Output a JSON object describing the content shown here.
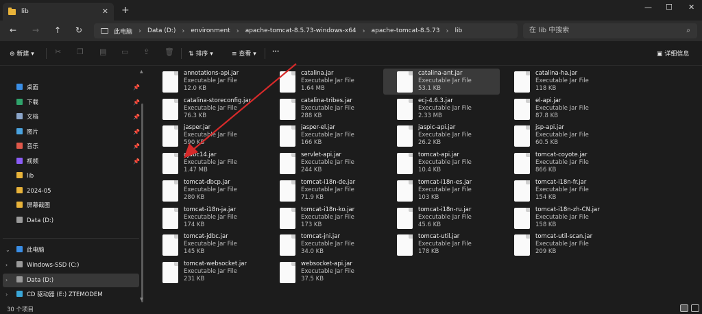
{
  "window": {
    "tab_title": "lib",
    "minimize": "—",
    "maximize": "☐",
    "close": "✕",
    "newtab": "+",
    "tab_close": "✕"
  },
  "nav": {
    "back": "←",
    "forward": "→",
    "up": "↑",
    "refresh": "↻"
  },
  "breadcrumb": [
    "此电脑",
    "Data (D:)",
    "environment",
    "apache-tomcat-8.5.73-windows-x64",
    "apache-tomcat-8.5.73",
    "lib"
  ],
  "search": {
    "placeholder": "在 lib 中搜索",
    "icon": "search-icon"
  },
  "toolbar": {
    "new_label": "新建",
    "sort_label": "排序",
    "view_label": "查看",
    "more": "···",
    "details_label": "详细信息"
  },
  "sidebar": {
    "quick": [
      {
        "label": "桌面",
        "icon": "desktop-icon",
        "color": "#3a8ee6",
        "pinned": true
      },
      {
        "label": "下载",
        "icon": "download-icon",
        "color": "#2fa36b",
        "pinned": true
      },
      {
        "label": "文档",
        "icon": "document-icon",
        "color": "#8aa4c8",
        "pinned": true
      },
      {
        "label": "图片",
        "icon": "picture-icon",
        "color": "#4aa3df",
        "pinned": true
      },
      {
        "label": "音乐",
        "icon": "music-icon",
        "color": "#e0584a",
        "pinned": true
      },
      {
        "label": "视频",
        "icon": "video-icon",
        "color": "#8b5cf6",
        "pinned": true
      },
      {
        "label": "lib",
        "icon": "folder-icon",
        "color": "#e8b33a",
        "pinned": false
      },
      {
        "label": "2024-05",
        "icon": "folder-icon",
        "color": "#e8b33a",
        "pinned": false
      },
      {
        "label": "屏幕截图",
        "icon": "folder-icon",
        "color": "#e8b33a",
        "pinned": false
      },
      {
        "label": "Data (D:)",
        "icon": "drive-icon",
        "color": "#9a9a9a",
        "pinned": false
      }
    ],
    "pc_label": "此电脑",
    "drives": [
      {
        "label": "Windows-SSD (C:)",
        "icon": "drive-icon"
      },
      {
        "label": "Data (D:)",
        "icon": "drive-icon"
      },
      {
        "label": "CD 驱动器 (E:) ZTEMODEM",
        "icon": "cd-icon"
      }
    ]
  },
  "files": [
    {
      "name": "annotations-api.jar",
      "type": "Executable Jar File",
      "size": "12.0 KB"
    },
    {
      "name": "catalina.jar",
      "type": "Executable Jar File",
      "size": "1.64 MB"
    },
    {
      "name": "catalina-ant.jar",
      "type": "Executable Jar File",
      "size": "53.1 KB",
      "selected": true
    },
    {
      "name": "catalina-ha.jar",
      "type": "Executable Jar File",
      "size": "118 KB"
    },
    {
      "name": "catalina-storeconfig.jar",
      "type": "Executable Jar File",
      "size": "76.3 KB"
    },
    {
      "name": "catalina-tribes.jar",
      "type": "Executable Jar File",
      "size": "288 KB"
    },
    {
      "name": "ecj-4.6.3.jar",
      "type": "Executable Jar File",
      "size": "2.33 MB"
    },
    {
      "name": "el-api.jar",
      "type": "Executable Jar File",
      "size": "87.8 KB"
    },
    {
      "name": "jasper.jar",
      "type": "Executable Jar File",
      "size": "590 KB"
    },
    {
      "name": "jasper-el.jar",
      "type": "Executable Jar File",
      "size": "166 KB"
    },
    {
      "name": "jaspic-api.jar",
      "type": "Executable Jar File",
      "size": "26.2 KB"
    },
    {
      "name": "jsp-api.jar",
      "type": "Executable Jar File",
      "size": "60.5 KB"
    },
    {
      "name": "ojdbc14.jar",
      "type": "Executable Jar File",
      "size": "1.47 MB"
    },
    {
      "name": "servlet-api.jar",
      "type": "Executable Jar File",
      "size": "244 KB"
    },
    {
      "name": "tomcat-api.jar",
      "type": "Executable Jar File",
      "size": "10.4 KB"
    },
    {
      "name": "tomcat-coyote.jar",
      "type": "Executable Jar File",
      "size": "866 KB"
    },
    {
      "name": "tomcat-dbcp.jar",
      "type": "Executable Jar File",
      "size": "280 KB"
    },
    {
      "name": "tomcat-i18n-de.jar",
      "type": "Executable Jar File",
      "size": "71.9 KB"
    },
    {
      "name": "tomcat-i18n-es.jar",
      "type": "Executable Jar File",
      "size": "103 KB"
    },
    {
      "name": "tomcat-i18n-fr.jar",
      "type": "Executable Jar File",
      "size": "154 KB"
    },
    {
      "name": "tomcat-i18n-ja.jar",
      "type": "Executable Jar File",
      "size": "174 KB"
    },
    {
      "name": "tomcat-i18n-ko.jar",
      "type": "Executable Jar File",
      "size": "173 KB"
    },
    {
      "name": "tomcat-i18n-ru.jar",
      "type": "Executable Jar File",
      "size": "45.6 KB"
    },
    {
      "name": "tomcat-i18n-zh-CN.jar",
      "type": "Executable Jar File",
      "size": "158 KB"
    },
    {
      "name": "tomcat-jdbc.jar",
      "type": "Executable Jar File",
      "size": "145 KB"
    },
    {
      "name": "tomcat-jni.jar",
      "type": "Executable Jar File",
      "size": "34.0 KB"
    },
    {
      "name": "tomcat-util.jar",
      "type": "Executable Jar File",
      "size": "178 KB"
    },
    {
      "name": "tomcat-util-scan.jar",
      "type": "Executable Jar File",
      "size": "209 KB"
    },
    {
      "name": "tomcat-websocket.jar",
      "type": "Executable Jar File",
      "size": "231 KB"
    },
    {
      "name": "websocket-api.jar",
      "type": "Executable Jar File",
      "size": "37.5 KB"
    }
  ],
  "status": {
    "count": "30 个项目"
  },
  "colors": {
    "accent": "#e8b33a",
    "annotation_arrow": "#d62a2a"
  }
}
